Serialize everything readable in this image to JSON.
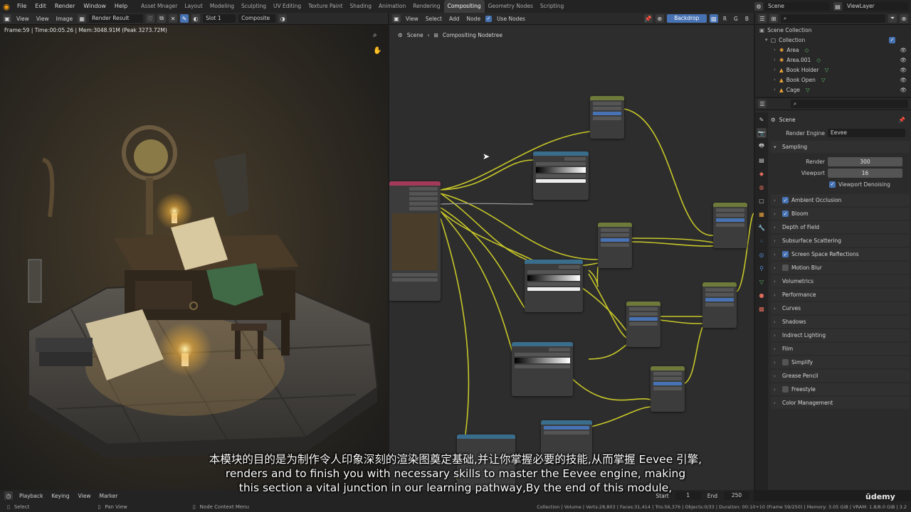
{
  "menu": {
    "items": [
      "File",
      "Edit",
      "Render",
      "Window",
      "Help"
    ],
    "workspaces": [
      "Asset Mnager",
      "Layout",
      "Modeling",
      "Sculpting",
      "UV Editing",
      "Texture Paint",
      "Shading",
      "Animation",
      "Rendering",
      "Compositing",
      "Geometry Nodes",
      "Scripting"
    ],
    "active_workspace": "Compositing",
    "scene": "Scene",
    "view_layer": "ViewLayer"
  },
  "viewer": {
    "view_label": "View",
    "view2": "View",
    "image_label": "Image",
    "image_name": "Render Result",
    "slot": "Slot 1",
    "pass": "Composite",
    "frame_info": "Frame:59 | Time:00:05.26 | Mem:3048.91M (Peak 3273.72M)"
  },
  "node_editor": {
    "view": "View",
    "select": "Select",
    "add": "Add",
    "node": "Node",
    "use_nodes": "Use Nodes",
    "backdrop": "Backdrop",
    "channels": [
      "R",
      "G",
      "B"
    ],
    "breadcrumb_scene": "Scene",
    "breadcrumb_tree": "Compositing Nodetree"
  },
  "outliner": {
    "root": "Scene Collection",
    "collection": "Collection",
    "items": [
      "Area",
      "Area.001",
      "Book Holder",
      "Book Open",
      "Cage"
    ]
  },
  "properties": {
    "title": "Scene",
    "render_engine_label": "Render Engine",
    "render_engine": "Eevee",
    "sampling": "Sampling",
    "render_label": "Render",
    "render_value": "300",
    "viewport_label": "Viewport",
    "viewport_value": "16",
    "viewport_denoising": "Viewport Denoising",
    "panels": [
      {
        "label": "Ambient Occlusion",
        "checkbox": true,
        "checked": true
      },
      {
        "label": "Bloom",
        "checkbox": true,
        "checked": true
      },
      {
        "label": "Depth of Field",
        "checkbox": false,
        "checked": false
      },
      {
        "label": "Subsurface Scattering",
        "checkbox": false,
        "checked": false
      },
      {
        "label": "Screen Space Reflections",
        "checkbox": true,
        "checked": true
      },
      {
        "label": "Motion Blur",
        "checkbox": true,
        "checked": false
      },
      {
        "label": "Volumetrics",
        "checkbox": false,
        "checked": false
      },
      {
        "label": "Performance",
        "checkbox": false,
        "checked": false
      },
      {
        "label": "Curves",
        "checkbox": false,
        "checked": false
      },
      {
        "label": "Shadows",
        "checkbox": false,
        "checked": false
      },
      {
        "label": "Indirect Lighting",
        "checkbox": false,
        "checked": false
      },
      {
        "label": "Film",
        "checkbox": false,
        "checked": false
      },
      {
        "label": "Simplify",
        "checkbox": true,
        "checked": false
      },
      {
        "label": "Grease Pencil",
        "checkbox": false,
        "checked": false
      },
      {
        "label": "Freestyle",
        "checkbox": true,
        "checked": false
      },
      {
        "label": "Color Management",
        "checkbox": false,
        "checked": false
      }
    ]
  },
  "timeline": {
    "playback": "Playback",
    "keying": "Keying",
    "view": "View",
    "marker": "Marker",
    "start_label": "Start",
    "start": "1",
    "end_label": "End",
    "end": "250"
  },
  "status": {
    "select": "Select",
    "pan_view": "Pan View",
    "node_context_menu": "Node Context Menu",
    "stats": "Collection | Volume | Verts:28,803 | Faces:31,414 | Tris:56,376 | Objects:0/33 | Duration: 00:10+10 (Frame 59/250) | Memory: 3.05 GiB | VRAM: 1.8/8.0 GiB | 3.2"
  },
  "subtitles": {
    "line_zh": "本模块的目的是为制作令人印象深刻的渲染图奠定基础,并让你掌握必要的技能,从而掌握 Eevee 引擎,",
    "line1": "renders and to finish you with necessary skills to master the Eevee engine, making",
    "line2": "this section a vital junction in our learning pathway,By the end of this module,"
  },
  "watermark": "ūdemy",
  "colors": {
    "accent": "#4772b3",
    "node_wire": "#c7c729",
    "orange": "#f39c12"
  }
}
